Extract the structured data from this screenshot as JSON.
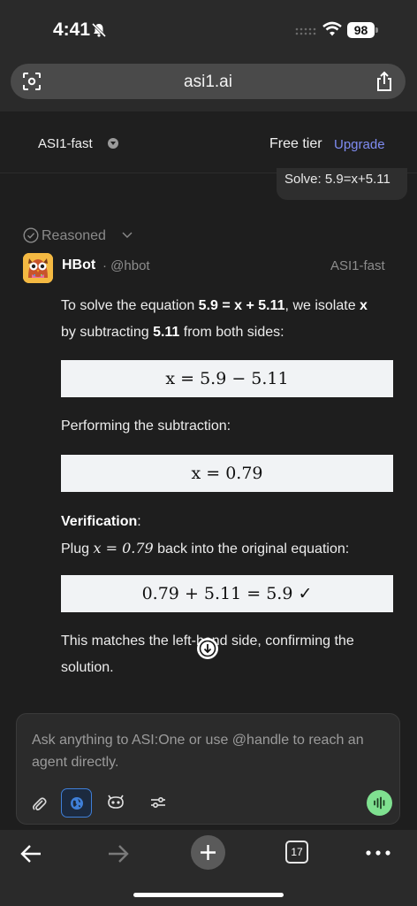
{
  "status_bar": {
    "time": "4:41",
    "battery": "98"
  },
  "browser": {
    "url": "asi1.ai"
  },
  "app_bar": {
    "model": "ASI1-fast",
    "tier": "Free tier",
    "upgrade": "Upgrade"
  },
  "chat": {
    "user_message": "Solve: 5.9=x+5.11",
    "reasoned_label": "Reasoned",
    "bot": {
      "name": "HBot",
      "handle": "@hbot",
      "model": "ASI1-fast"
    },
    "response": {
      "intro_pre": "To solve the equation ",
      "intro_eq": "5.9 = x + 5.11",
      "intro_mid": ", we isolate ",
      "intro_var": "x",
      "intro_line2_pre": "by subtracting ",
      "intro_num": "5.11",
      "intro_line2_post": " from both sides:",
      "eq1": "x = 5.9 − 5.11",
      "performing": "Performing the subtraction:",
      "eq2": "x = 0.79",
      "verification_label": "Verification",
      "verification_colon": ":",
      "plug_pre": "Plug ",
      "plug_math": "x = 0.79",
      "plug_post": " back into the original equation:",
      "eq3": "0.79 + 5.11 = 5.9   ✓",
      "conclusion": "This matches the left-hand side, confirming the solution."
    }
  },
  "composer": {
    "placeholder": "Ask anything to ASI:One or use @handle to reach an agent directly."
  },
  "toolbar": {
    "tab_count": "17"
  },
  "colors": {
    "accent": "#7f8cf2",
    "voice": "#7fe090",
    "background": "#1e1e1e"
  }
}
